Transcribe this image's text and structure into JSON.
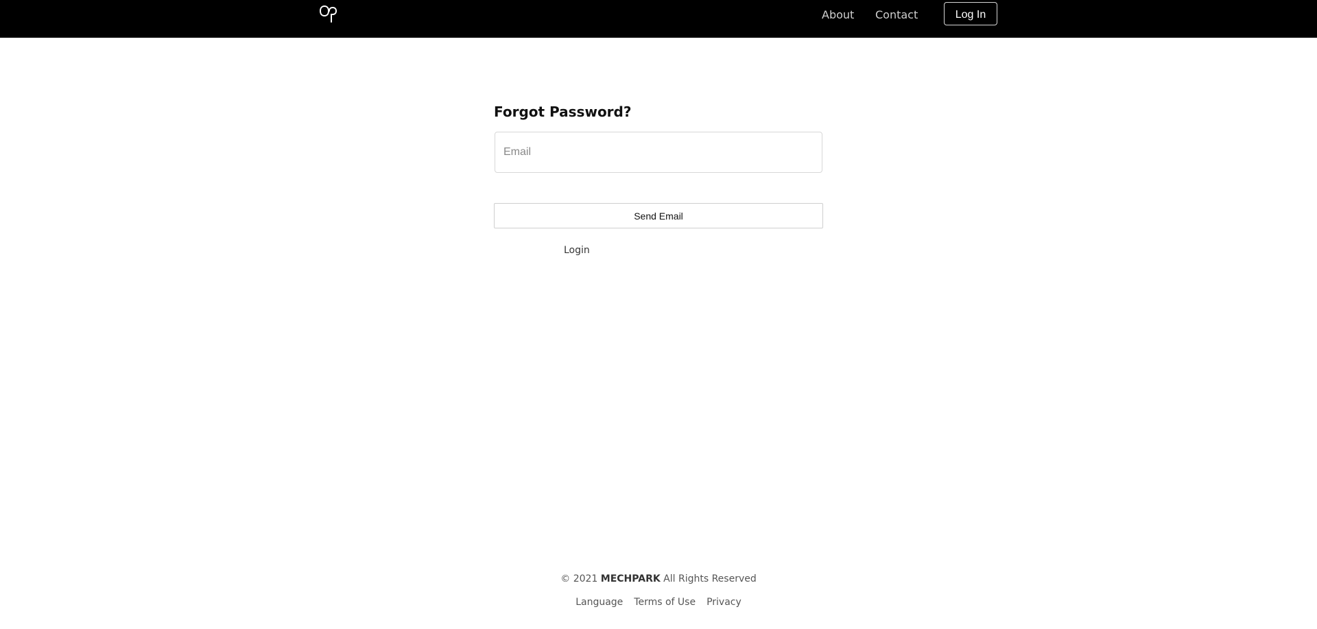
{
  "header": {
    "nav": {
      "about": "About",
      "contact": "Contact"
    },
    "login_button": "Log In",
    "logo_icon": "logo-icon"
  },
  "form": {
    "title": "Forgot Password?",
    "email_placeholder": "Email",
    "send_button": "Send Email",
    "login_link": "Login"
  },
  "footer": {
    "copyright_prefix": "© 2021 ",
    "brand": "MECHPARK",
    "copyright_suffix": " All Rights Reserved",
    "links": [
      "Language",
      "Terms of Use",
      "Privacy"
    ]
  },
  "colors": {
    "header_bg": "#000000",
    "page_bg": "#ffffff",
    "text_primary": "#111111",
    "text_muted": "#555555",
    "border": "#d7d7d7"
  }
}
